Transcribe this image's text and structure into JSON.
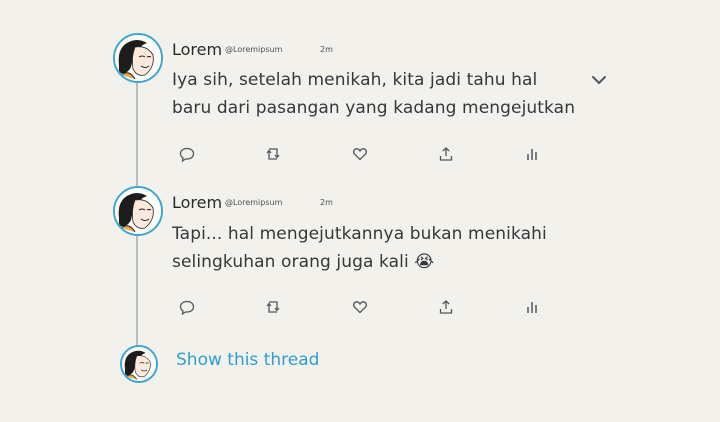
{
  "tweets": [
    {
      "name": "Lorem",
      "handle": "@Loremipsum",
      "time": "2m",
      "lines": [
        "Iya sih, setelah menikah, kita jadi tahu hal",
        "baru dari pasangan yang kadang mengejutkan"
      ]
    },
    {
      "name": "Lorem",
      "handle": "@Loremipsum",
      "time": "2m",
      "lines": [
        "Tapi... hal mengejutkannya bukan menikahi",
        "selingkuhan orang juga kali 😭"
      ]
    }
  ],
  "icons": {
    "reply": "reply-icon",
    "retweet": "retweet-icon",
    "like": "heart-icon",
    "share": "share-icon",
    "analytics": "analytics-icon",
    "more": "chevron-down-icon"
  },
  "show_thread": "Show this thread",
  "colors": {
    "background": "#f3f1ec",
    "avatar_ring": "#3aa7d3",
    "link": "#2f9fd3",
    "thread_line": "#b9bec2",
    "icon": "#50585e"
  }
}
